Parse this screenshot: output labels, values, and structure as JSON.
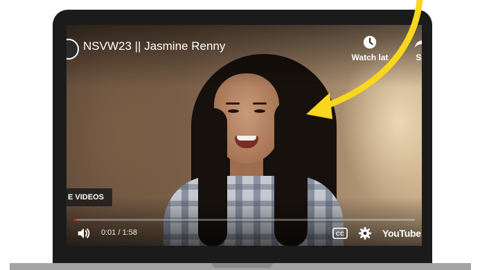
{
  "player": {
    "title": "NSVW23 || Jasmine Renny",
    "watch_later_label": "Watch lat",
    "share_label": "Sh",
    "more_videos_label": "E VIDEOS",
    "time_display": "0:01 / 1:58",
    "progress_fraction": 0.009,
    "brand_label": "YouTube"
  },
  "colors": {
    "annotation_arrow": "#f9d71c",
    "progress_played": "#ff0000"
  },
  "icons": {
    "watch_later": "clock-icon",
    "share": "share-arrow-icon",
    "volume": "volume-icon",
    "captions": "cc-icon",
    "settings": "gear-icon"
  }
}
